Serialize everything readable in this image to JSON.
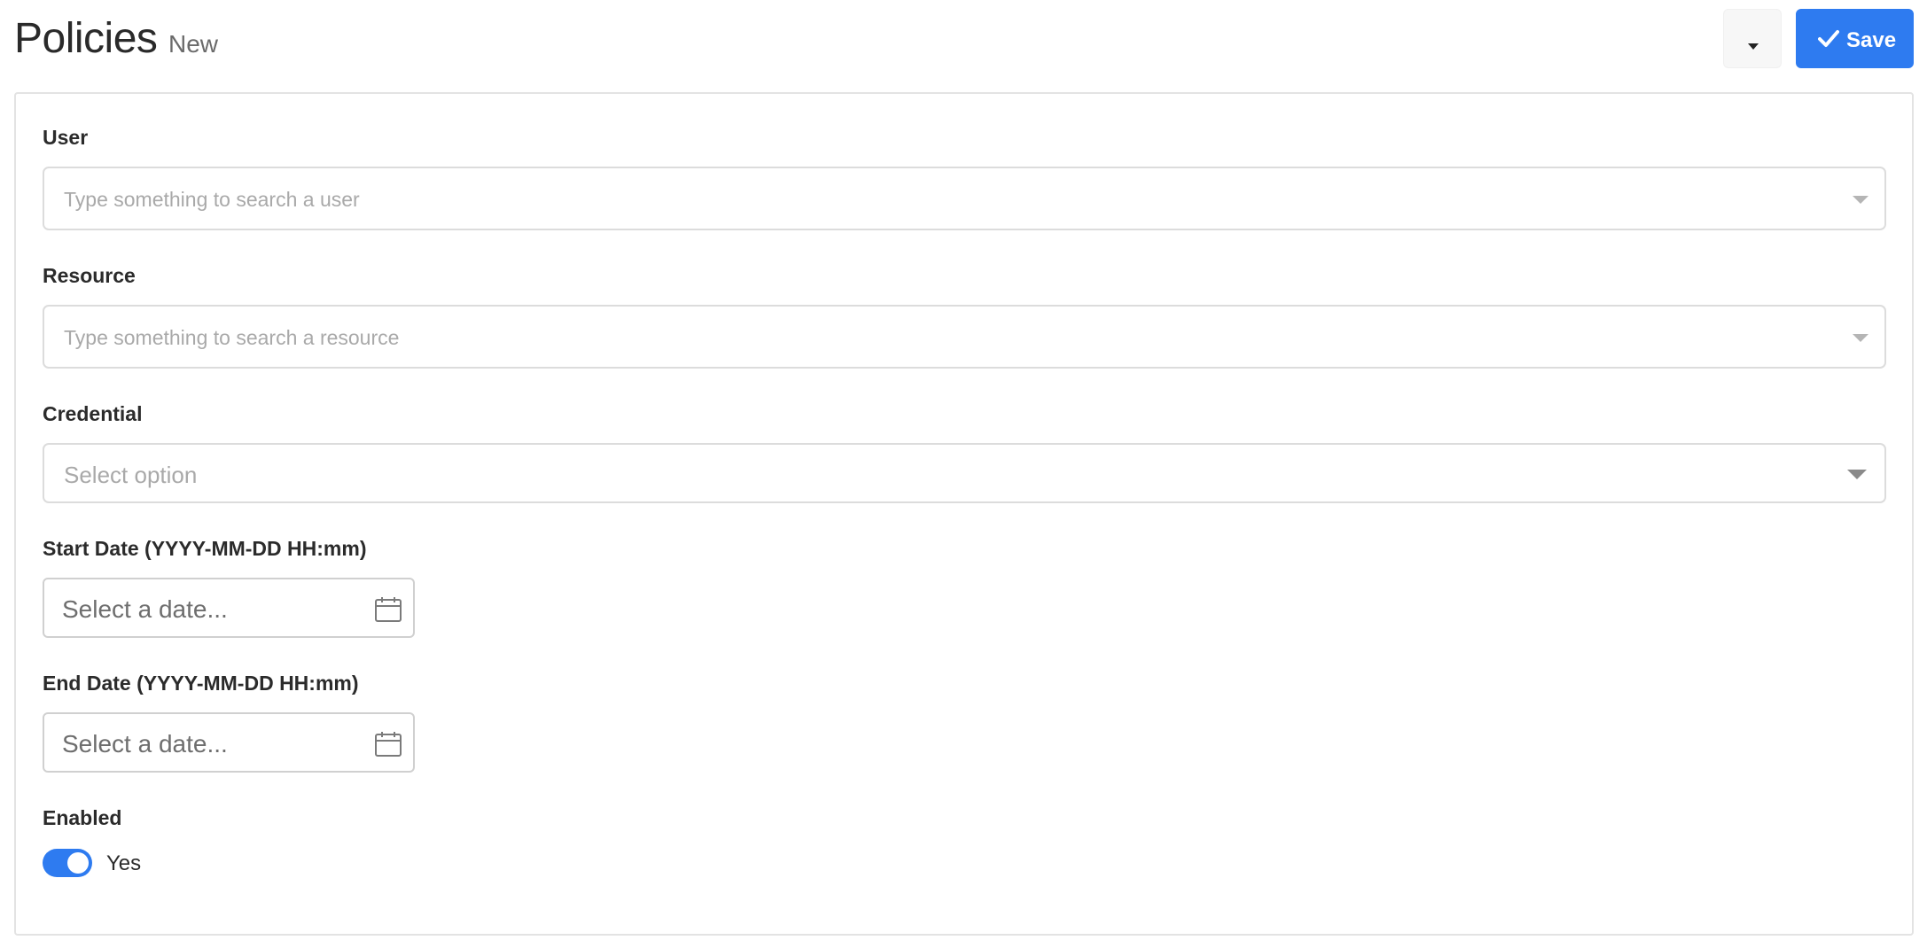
{
  "header": {
    "title": "Policies",
    "subtitle": "New",
    "save_label": "Save",
    "dropdown_icon": "caret-down-icon",
    "save_icon": "check-icon"
  },
  "form": {
    "user": {
      "label": "User",
      "placeholder": "Type something to search a user"
    },
    "resource": {
      "label": "Resource",
      "placeholder": "Type something to search a resource"
    },
    "credential": {
      "label": "Credential",
      "placeholder": "Select option"
    },
    "start_date": {
      "label": "Start Date (YYYY-MM-DD HH:mm)",
      "placeholder": "Select a date..."
    },
    "end_date": {
      "label": "End Date (YYYY-MM-DD HH:mm)",
      "placeholder": "Select a date..."
    },
    "enabled": {
      "label": "Enabled",
      "value_label": "Yes",
      "checked": true
    }
  },
  "colors": {
    "accent": "#2e7bf0",
    "border": "#dcdcdc",
    "placeholder": "#a9a9a9"
  }
}
